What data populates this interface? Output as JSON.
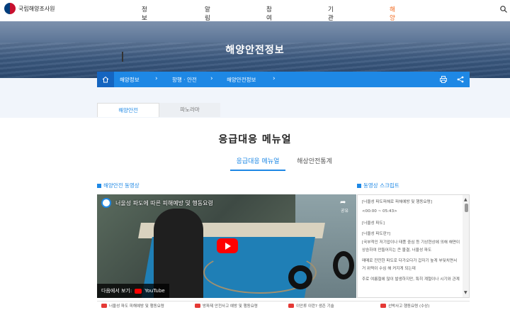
{
  "header": {
    "logo_text": "국립해양조사원",
    "nav": [
      "정보공개",
      "알림마당",
      "참여마당",
      "기관소개",
      "해양정보"
    ],
    "active_nav": "해양정보",
    "accent": "#f26b21"
  },
  "hero": {
    "title": "해양안전정보"
  },
  "breadcrumb": {
    "items": [
      "해양정보",
      "항행 · 안전",
      "해양안전정보"
    ],
    "color": "#1e88e5"
  },
  "tabs": {
    "items": [
      "해양안전",
      "파노라마"
    ],
    "active": "해양안전"
  },
  "section": {
    "title": "응급대응 메뉴얼",
    "subtabs": [
      "응급대응 메뉴얼",
      "해상안전통계"
    ],
    "active_subtab": "응급대응 메뉴얼"
  },
  "video_panel": {
    "label": "해양안전 동영상",
    "video_title": "너울성 파도에 따른 피해예방 및 행동요령",
    "share_label": "공유",
    "watch_on": "다음에서 보기:",
    "watch_brand": "YouTube"
  },
  "script_panel": {
    "label": "동영상 스크립트",
    "lines": [
      "[너울성 파도피해로 피해예방 및 행동요령]",
      "<00:00 ~ 05:43>",
      "[너울성 파도]",
      "[너울성 파도란?]",
      "[국부적인 저기압이나 태풍 중심 등 기상현상에 의해 해면이",
      "상승하여 만들어지는 큰 물결, 너울성 파도",
      "매매로 잔잔한 파도로 다가오다가 갑자기 높게 부딪치면서",
      "거 위력이 수심 해 커지게 되는데",
      "주로 여름철에 많이 발생하지만, 특히 계절이나 시기와 관계"
    ]
  },
  "playlist": [
    "너울성 파도 피해예방 및 행동요령",
    "방파제 안전사고 예방 및 행동요령",
    "이안류 이란? 생존 기술",
    "선박사고 행동요령 (수상)"
  ]
}
